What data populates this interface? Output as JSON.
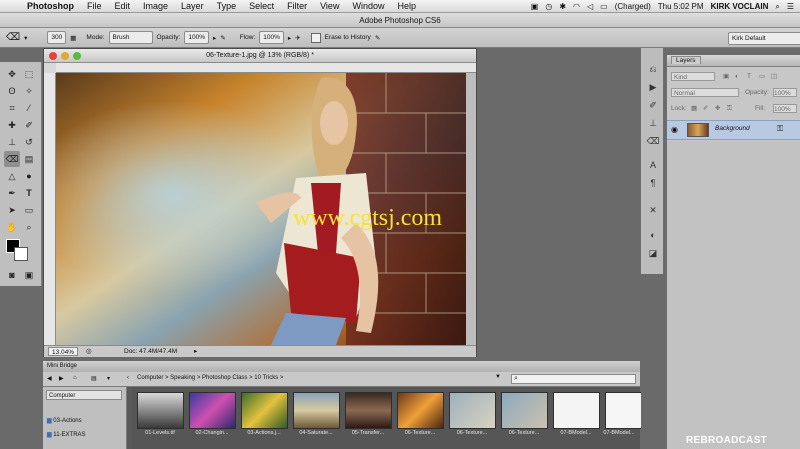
{
  "menubar": {
    "app_name": "Photoshop",
    "items": [
      "File",
      "Edit",
      "Image",
      "Layer",
      "Type",
      "Select",
      "Filter",
      "View",
      "Window",
      "Help"
    ],
    "battery": "(Charged)",
    "clock": "Thu 5:02 PM",
    "user": "KIRK VOCLAIN"
  },
  "window_title": "Adobe Photoshop CS6",
  "options_bar": {
    "brush_size": "300",
    "mode_label": "Mode:",
    "mode_value": "Brush",
    "opacity_label": "Opacity:",
    "opacity_value": "100%",
    "flow_label": "Flow:",
    "flow_value": "100%",
    "erase_history": "Erase to History",
    "workspace": "Kirk Default"
  },
  "document": {
    "title": "06-Texture-1.jpg @ 13% (RGB/8) *",
    "zoom": "13.04%",
    "doc_size": "Doc: 47.4M/47.4M"
  },
  "layers_panel": {
    "tab": "Layers",
    "filter": "Kind",
    "blend_mode": "Normal",
    "opacity_label": "Opacity:",
    "opacity_value": "100%",
    "lock_label": "Lock:",
    "fill_label": "Fill:",
    "fill_value": "100%",
    "layer_name": "Background"
  },
  "mini_bridge": {
    "tab": "Mini Bridge",
    "breadcrumb": "Computer > Speaking > Photoshop Class > 10 Tricks >",
    "search_placeholder": "",
    "location": "Computer",
    "folders": [
      "03-Actions",
      "11-EXTRAS"
    ],
    "thumbnails": [
      "01-Levels.tif",
      "02-Changin...",
      "03-Actions.j...",
      "04-Saturate...",
      "05-Transfer...",
      "06-Texture...",
      "06-Texture...",
      "06-Texture...",
      "07-BModel...",
      "07-BModel..."
    ]
  },
  "overlay": {
    "watermark": "www.cgtsj.com",
    "badge": "REBROADCAST"
  },
  "colors": {
    "accent_blue": "#b8c9e3",
    "watermark_yellow": "#f3e23a"
  }
}
